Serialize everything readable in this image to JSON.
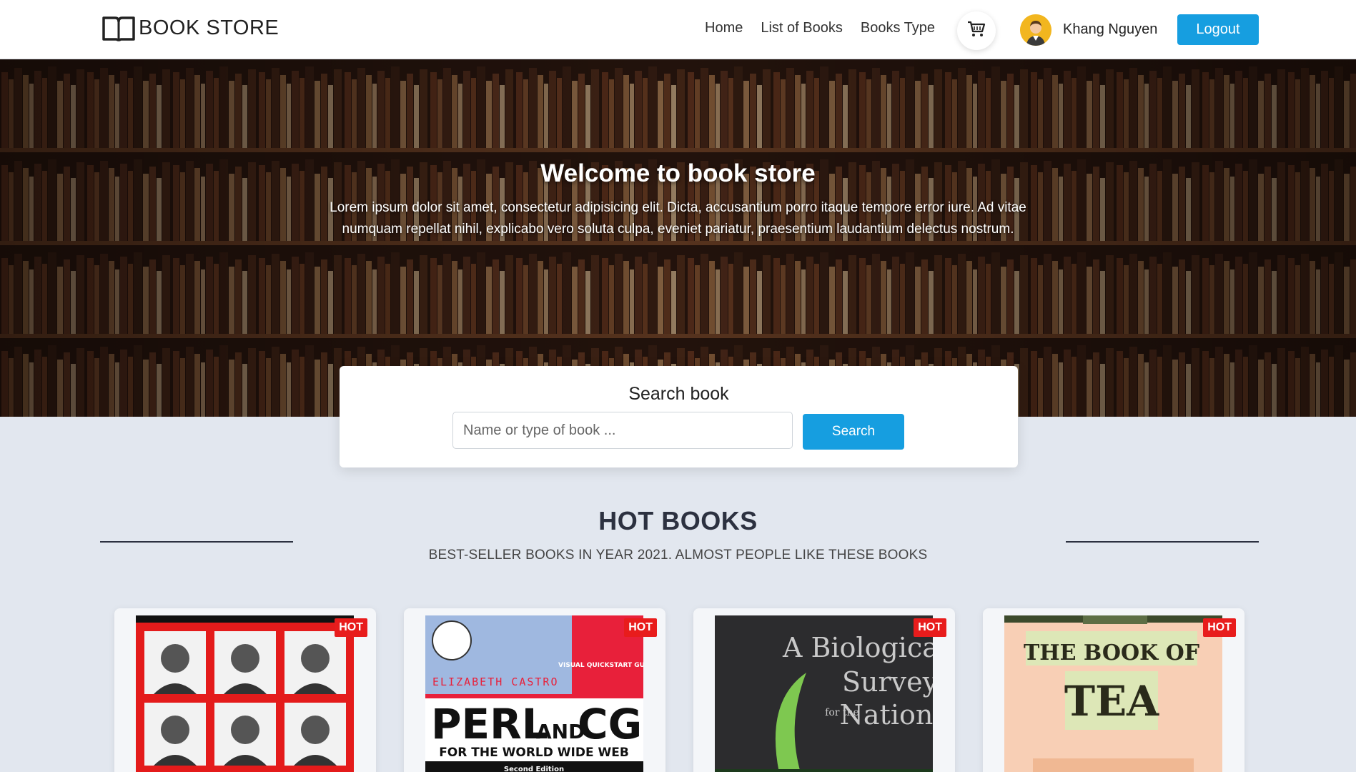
{
  "navbar": {
    "brand": "BOOK STORE",
    "links": [
      "Home",
      "List of Books",
      "Books Type"
    ],
    "user_name": "Khang Nguyen",
    "logout_label": "Logout",
    "accent_color": "#169ee0"
  },
  "hero": {
    "title": "Welcome to book store",
    "text": "Lorem ipsum dolor sit amet, consectetur adipisicing elit. Dicta, accusantium porro itaque tempore error iure. Ad vitae numquam repellat nihil, explicabo vero soluta culpa, eveniet pariatur, praesentium laudantium delectus nostrum."
  },
  "search": {
    "title": "Search book",
    "placeholder": "Name or type of book ...",
    "button_label": "Search"
  },
  "hot_books": {
    "title": "HOT BOOKS",
    "subtitle": "BEST-SELLER BOOKS IN YEAR 2021. ALMOST PEOPLE LIKE THESE BOOKS",
    "badge": "HOT",
    "badge_color": "#e81c1c",
    "books": [
      {
        "cover_text": [],
        "cover_style": "portraits-red"
      },
      {
        "cover_text": [
          "ELIZABETH CASTRO",
          "VISUAL QUICKSTART GUIDE",
          "PERL",
          "AND",
          "CGI",
          "FOR THE WORLD WIDE WEB",
          "Second Edition"
        ],
        "cover_style": "perl"
      },
      {
        "cover_text": [
          "A Biological",
          "Survey",
          "for the",
          "Nation"
        ],
        "cover_style": "biology"
      },
      {
        "cover_text": [
          "THE BOOK OF",
          "TEA"
        ],
        "cover_style": "tea"
      }
    ]
  }
}
